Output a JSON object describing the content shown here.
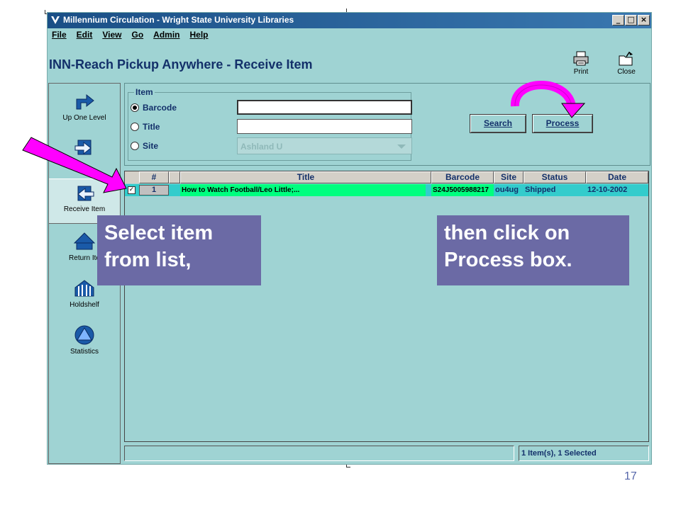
{
  "window": {
    "title": "Millennium Circulation - Wright State University Libraries",
    "controls": {
      "minimize": "_",
      "maximize": "□",
      "close": "×"
    }
  },
  "menu": [
    {
      "label": "File"
    },
    {
      "label": "Edit"
    },
    {
      "label": "View"
    },
    {
      "label": "Go"
    },
    {
      "label": "Admin"
    },
    {
      "label": "Help"
    }
  ],
  "page": {
    "heading": "INN-Reach Pickup Anywhere - Receive Item"
  },
  "toolbar": {
    "print_label": "Print",
    "close_label": "Close"
  },
  "sidebar": {
    "items": [
      {
        "label": "Up One Level",
        "icon": "up-arrow-icon"
      },
      {
        "label": "",
        "icon": "send-item-icon"
      },
      {
        "label": "Receive Item",
        "icon": "receive-item-icon"
      },
      {
        "label": "Return Ite",
        "icon": "return-item-icon"
      },
      {
        "label": "Holdshelf",
        "icon": "holdshelf-icon"
      },
      {
        "label": "Statistics",
        "icon": "statistics-icon"
      }
    ]
  },
  "search": {
    "group_label": "Item",
    "options": [
      {
        "label": "Barcode",
        "selected": true
      },
      {
        "label": "Title",
        "selected": false
      },
      {
        "label": "Site",
        "selected": false
      }
    ],
    "barcode_value": "",
    "title_value": "",
    "site_value": "Ashland U",
    "search_button": "Search",
    "process_button": "Process"
  },
  "results": {
    "columns": [
      "#",
      "Title",
      "Barcode",
      "Site",
      "Status",
      "Date"
    ],
    "rows": [
      {
        "checked": true,
        "num": "1",
        "title": "How to Watch Football/Leo Little;...",
        "barcode": "S24J5005988217",
        "site": "ou4ug",
        "status": "Shipped",
        "date": "12-10-2002"
      }
    ]
  },
  "statusbar": {
    "left": "",
    "right": "1 Item(s), 1 Selected"
  },
  "annotations": {
    "callout_left": "Select item from list,",
    "callout_right": "then click on Process box."
  },
  "colors": {
    "app_bg": "#9fd3d3",
    "title_text": "#13306a",
    "selected_cell": "#00ff7f",
    "row_highlight": "#33cccc",
    "callout_bg": "#6b6aa5",
    "arrow": "#ff00ff"
  },
  "slide": {
    "number": "17"
  }
}
